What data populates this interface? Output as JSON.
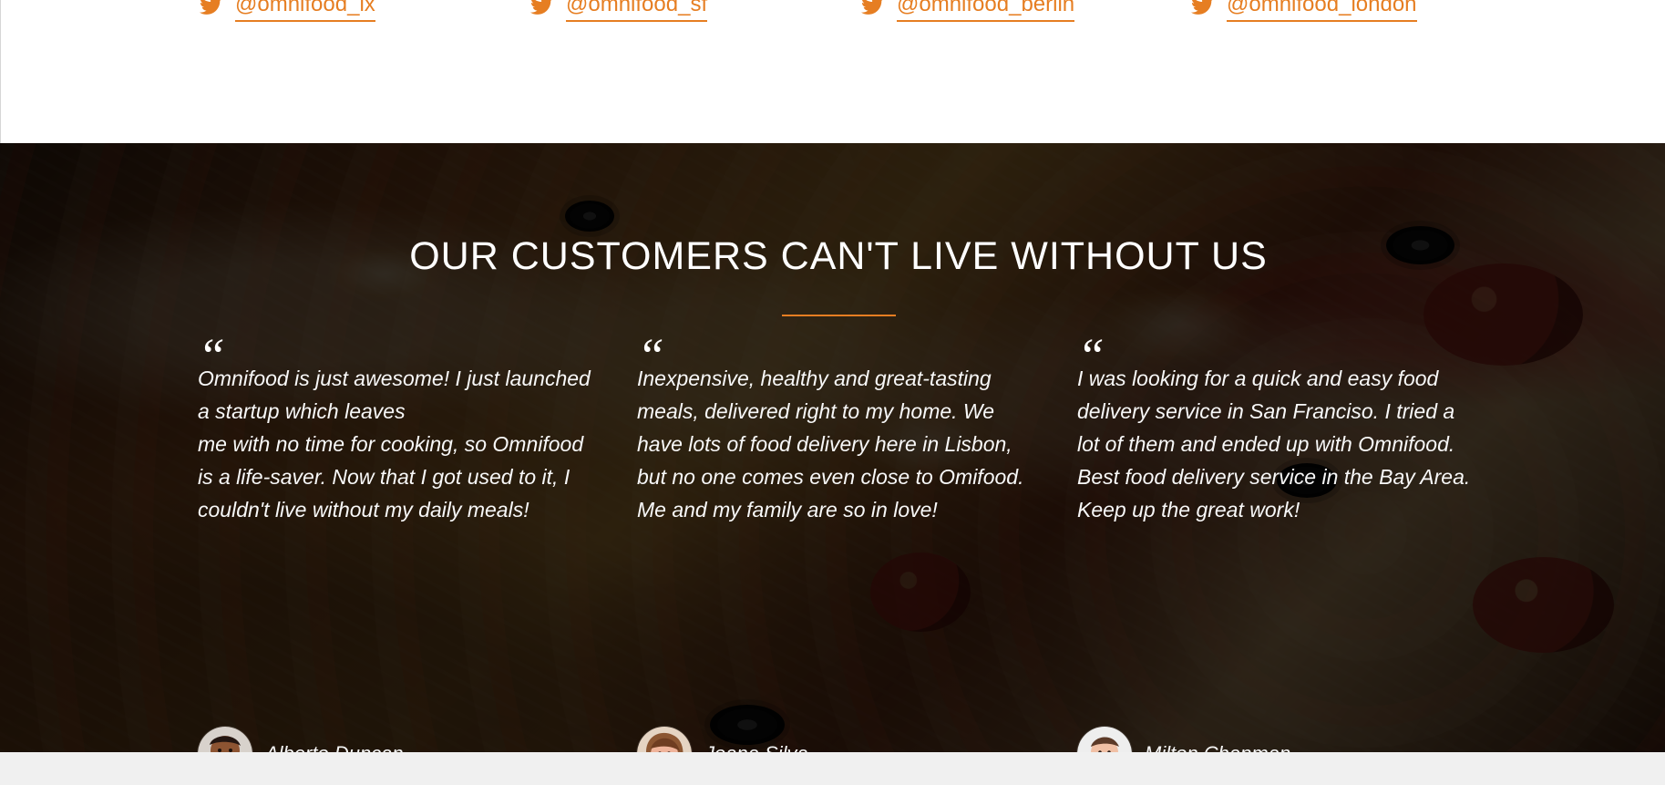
{
  "social": {
    "items": [
      {
        "icon": "twitter-icon",
        "handle": "@omnifood_lx"
      },
      {
        "icon": "twitter-icon",
        "handle": "@omnifood_sf"
      },
      {
        "icon": "twitter-icon",
        "handle": "@omnifood_berlin"
      },
      {
        "icon": "twitter-icon",
        "handle": "@omnifood_london"
      }
    ],
    "accent_color": "#e67e22"
  },
  "testimonials": {
    "title": "OUR CUSTOMERS CAN'T LIVE WITHOUT US",
    "quote_mark": "“",
    "accent_color": "#e67e22",
    "items": [
      {
        "text": "Omnifood is just awesome! I just launched a startup which leaves\nme with no time for cooking, so Omnifood is a life-saver. Now that I got used to it, I couldn't live without my daily meals!",
        "customer": "Alberto Duncan",
        "avatar": "customer-avatar"
      },
      {
        "text": "Inexpensive, healthy and great-tasting meals, delivered right to my home. We have lots of food delivery here in Lisbon, but no one comes even close to Omifood. Me and my family are so in love!",
        "customer": "Joana Silva",
        "avatar": "customer-avatar"
      },
      {
        "text": "I was looking for a quick and easy food delivery service in San Franciso. I tried a lot of them and ended up with Omnifood. Best food delivery service in the Bay Area. Keep up the great work!",
        "customer": "Milton Chapman",
        "avatar": "customer-avatar"
      }
    ]
  }
}
